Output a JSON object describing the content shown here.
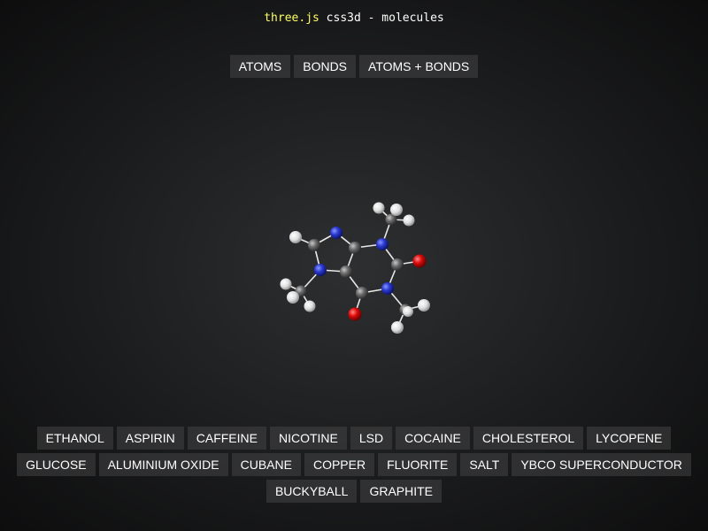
{
  "info": {
    "link": "three.js",
    "text": " css3d - molecules"
  },
  "view_modes": [
    "ATOMS",
    "BONDS",
    "ATOMS + BONDS"
  ],
  "molecule_rows": [
    [
      "ETHANOL",
      "ASPIRIN",
      "CAFFEINE",
      "NICOTINE",
      "LSD",
      "COCAINE",
      "CHOLESTEROL",
      "LYCOPENE"
    ],
    [
      "GLUCOSE",
      "ALUMINIUM OXIDE",
      "CUBANE",
      "COPPER",
      "FLUORITE",
      "SALT",
      "YBCO SUPERCONDUCTOR"
    ],
    [
      "BUCKYBALL",
      "GRAPHITE"
    ]
  ],
  "colors": {
    "carbon": "#8a8a8a",
    "nitrogen": "#3f4fe0",
    "oxygen": "#ee1111",
    "hydrogen": "#f2f2f2",
    "bond": "#e8e8e8",
    "button_bg": "#3a3b3d",
    "info_link": "#ffff66"
  }
}
